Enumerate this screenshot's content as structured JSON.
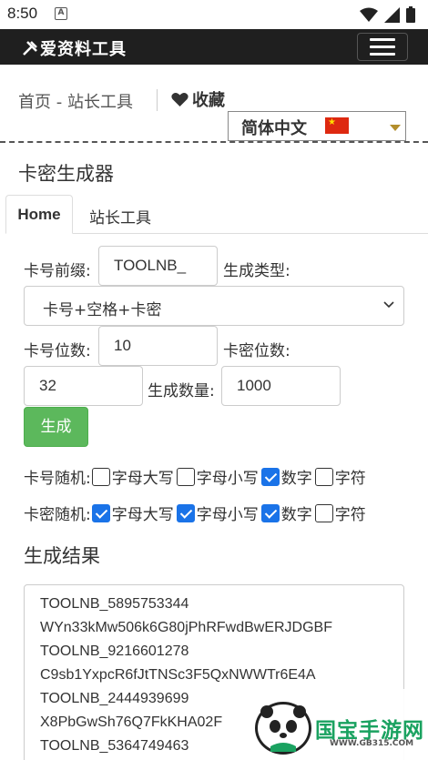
{
  "status_bar": {
    "time": "8:50",
    "notif_letter": "A"
  },
  "navbar": {
    "logo": "爱资料工具"
  },
  "breadcrumb": {
    "text": "首页 - 站长工具",
    "favorite": "收藏"
  },
  "language": {
    "selected": "简体中文"
  },
  "page_title": "卡密生成器",
  "tabs": [
    {
      "label": "Home",
      "active": true
    },
    {
      "label": "站长工具",
      "active": false
    }
  ],
  "form": {
    "prefix_label": "卡号前缀:",
    "prefix_value": "TOOLNB_",
    "type_label": "生成类型:",
    "type_selected": "卡号+空格+卡密",
    "card_digits_label": "卡号位数:",
    "card_digits_value": "10",
    "pwd_digits_label": "卡密位数:",
    "pwd_digits_value": "32",
    "count_label": "生成数量:",
    "count_value": "1000",
    "generate_button": "生成"
  },
  "random": {
    "card_label": "卡号随机:",
    "pwd_label": "卡密随机:",
    "options": [
      "字母大写",
      "字母小写",
      "数字",
      "字符"
    ],
    "card_checked": [
      false,
      false,
      true,
      false
    ],
    "pwd_checked": [
      true,
      true,
      true,
      false
    ]
  },
  "result": {
    "title": "生成结果",
    "lines": [
      "TOOLNB_5895753344",
      "WYn33kMw506k6G80jPhRFwdBwERJDGBF",
      "TOOLNB_9216601278",
      "C9sb1YxpcR6fJtTNSc3F5QxNWWTr6E4A",
      "TOOLNB_2444939699",
      "X8PbGwSh76Q7FkKHA02F",
      "TOOLNB_5364749463"
    ]
  },
  "watermark": {
    "text": "国宝手游网",
    "url": "WWW.GB315.COM"
  },
  "colors": {
    "navbar": "#1f1f1f",
    "green_button": "#5cb85c",
    "checkbox": "#1a73e8",
    "watermark_green": "#1aa260"
  }
}
